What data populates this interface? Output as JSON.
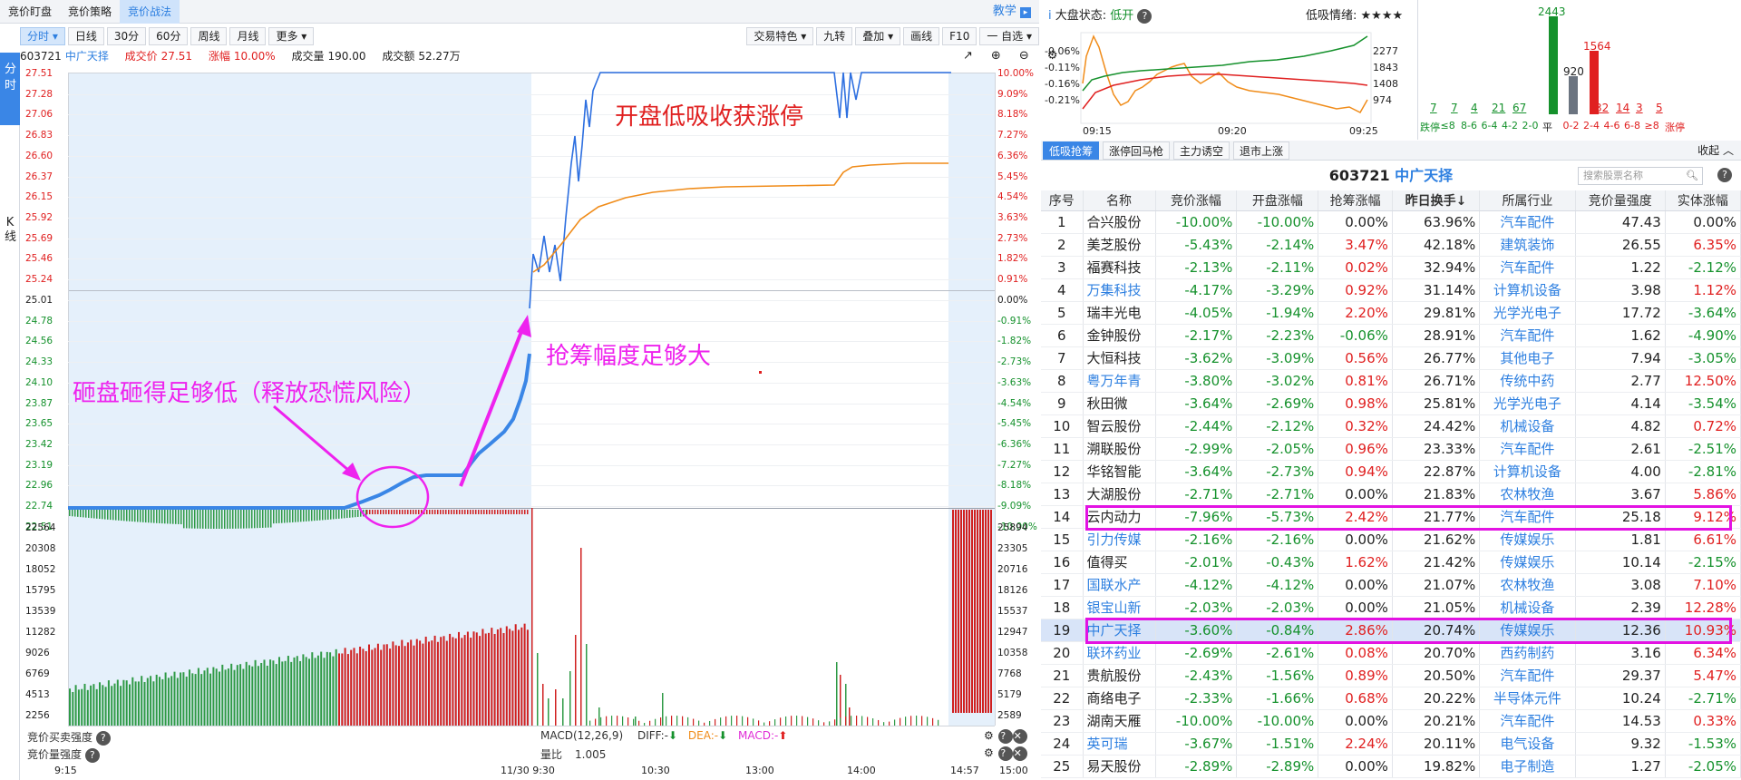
{
  "top_tabs": [
    "竞价盯盘",
    "竞价策略",
    "竞价战法"
  ],
  "teach": "教学",
  "side": {
    "fen": "分时",
    "k": "K线"
  },
  "toolbar_left": [
    "分时",
    "日线",
    "30分",
    "60分",
    "周线",
    "月线",
    "更多"
  ],
  "toolbar_right": [
    "交易特色",
    "九转",
    "叠加",
    "画线",
    "F10",
    "一 自选"
  ],
  "info": {
    "code": "603721",
    "name": "中广天择",
    "price_label": "成交价",
    "price": "27.51",
    "chg_label": "涨幅",
    "chg": "10.00%",
    "vol_label": "成交量",
    "vol": "190.00",
    "amt_label": "成交额",
    "amt": "52.27万"
  },
  "price_axis": [
    "27.51",
    "27.28",
    "27.06",
    "26.83",
    "26.60",
    "26.37",
    "26.15",
    "25.92",
    "25.69",
    "25.46",
    "25.24",
    "25.01",
    "24.78",
    "24.56",
    "24.33",
    "24.10",
    "23.87",
    "23.65",
    "23.42",
    "23.19",
    "22.96",
    "22.74",
    "22.51"
  ],
  "pct_axis": [
    "10.00%",
    "9.09%",
    "8.18%",
    "7.27%",
    "6.36%",
    "5.45%",
    "4.54%",
    "3.63%",
    "2.73%",
    "1.82%",
    "0.91%",
    "0.00%",
    "-0.91%",
    "-1.82%",
    "-2.73%",
    "-3.63%",
    "-4.54%",
    "-5.45%",
    "-6.36%",
    "-7.27%",
    "-8.18%",
    "-9.09%",
    "-10.00%"
  ],
  "vol_axis_left": [
    "22564",
    "20308",
    "18052",
    "15795",
    "13539",
    "11282",
    "9026",
    "6769",
    "4513",
    "2256"
  ],
  "vol_axis_right": [
    "25894",
    "23305",
    "20716",
    "18126",
    "15537",
    "12947",
    "10358",
    "7768",
    "5179",
    "2589"
  ],
  "bottom_labels": {
    "auction_strength": "竞价买卖强度",
    "auction_vol": "竞价量强度",
    "macd": "MACD(12,26,9)",
    "diff": "DIFF:-",
    "dea": "DEA:-",
    "macd_v": "MACD:-",
    "vr_label": "量比",
    "vr": "1.005"
  },
  "time_axis": [
    "9:15",
    "11/30 9:30",
    "10:30",
    "13:00",
    "14:00",
    "14:57",
    "15:00"
  ],
  "annotations": {
    "a1": "开盘低吸收获涨停",
    "a2": "抢筹幅度足够大",
    "a3": "砸盘砸得足够低（释放恐慌风险）"
  },
  "market": {
    "status_label": "大盘状态:",
    "status": "低开",
    "mood_label": "低吸情绪:",
    "mood": "★★★★",
    "left_axis": [
      "-0.06%",
      "-0.11%",
      "-0.16%",
      "-0.21%"
    ],
    "right_axis": [
      "2277",
      "1843",
      "1408",
      "974"
    ],
    "times": [
      "09:15",
      "09:20",
      "09:25"
    ]
  },
  "dist": {
    "tops": [
      "2443",
      "920",
      "1564"
    ],
    "counts": [
      "7",
      "7",
      "4",
      "21",
      "67",
      "",
      "",
      "32",
      "14",
      "3",
      "5"
    ],
    "labels": [
      "跌停",
      "≤8",
      "8-6",
      "6-4",
      "4-2",
      "2-0",
      "平",
      "0-2",
      "2-4",
      "4-6",
      "6-8",
      "≥8",
      "涨停"
    ]
  },
  "sub_tabs": [
    "低吸抢筹",
    "涨停回马枪",
    "主力诱空",
    "退市上涨"
  ],
  "collapse": "收起",
  "stock_title": {
    "code": "603721",
    "name": "中广天择"
  },
  "search_placeholder": "搜索股票名称",
  "headers": [
    "序号",
    "名称",
    "竞价涨幅",
    "开盘涨幅",
    "抢筹涨幅",
    "昨日换手↓",
    "所属行业",
    "竞价量强度",
    "实体涨幅"
  ],
  "rows": [
    [
      "1",
      "合兴股份",
      "-10.00%",
      "-10.00%",
      "0.00%",
      "63.96%",
      "汽车配件",
      "47.43",
      "0.00%"
    ],
    [
      "2",
      "美芝股份",
      "-5.43%",
      "-2.14%",
      "3.47%",
      "42.18%",
      "建筑装饰",
      "26.55",
      "6.35%"
    ],
    [
      "3",
      "福赛科技",
      "-2.13%",
      "-2.11%",
      "0.02%",
      "32.94%",
      "汽车配件",
      "1.22",
      "-2.12%"
    ],
    [
      "4",
      "万集科技",
      "-4.17%",
      "-3.29%",
      "0.92%",
      "31.14%",
      "计算机设备",
      "3.98",
      "1.12%"
    ],
    [
      "5",
      "瑞丰光电",
      "-4.05%",
      "-1.94%",
      "2.20%",
      "29.81%",
      "光学光电子",
      "17.72",
      "-3.64%"
    ],
    [
      "6",
      "金钟股份",
      "-2.17%",
      "-2.23%",
      "-0.06%",
      "28.91%",
      "汽车配件",
      "1.62",
      "-4.90%"
    ],
    [
      "7",
      "大恒科技",
      "-3.62%",
      "-3.09%",
      "0.56%",
      "26.77%",
      "其他电子",
      "7.94",
      "-3.05%"
    ],
    [
      "8",
      "粤万年青",
      "-3.80%",
      "-3.02%",
      "0.81%",
      "26.71%",
      "传统中药",
      "2.77",
      "12.50%"
    ],
    [
      "9",
      "秋田微",
      "-3.64%",
      "-2.69%",
      "0.98%",
      "25.81%",
      "光学光电子",
      "4.14",
      "-3.54%"
    ],
    [
      "10",
      "智云股份",
      "-2.44%",
      "-2.12%",
      "0.32%",
      "24.42%",
      "机械设备",
      "4.82",
      "0.72%"
    ],
    [
      "11",
      "溯联股份",
      "-2.99%",
      "-2.05%",
      "0.96%",
      "23.33%",
      "汽车配件",
      "2.61",
      "-2.51%"
    ],
    [
      "12",
      "华铭智能",
      "-3.64%",
      "-2.73%",
      "0.94%",
      "22.87%",
      "计算机设备",
      "4.00",
      "-2.81%"
    ],
    [
      "13",
      "大湖股份",
      "-2.71%",
      "-2.71%",
      "0.00%",
      "21.83%",
      "农林牧渔",
      "3.67",
      "5.86%"
    ],
    [
      "14",
      "云内动力",
      "-7.96%",
      "-5.73%",
      "2.42%",
      "21.77%",
      "汽车配件",
      "25.18",
      "9.12%"
    ],
    [
      "15",
      "引力传媒",
      "-2.16%",
      "-2.16%",
      "0.00%",
      "21.62%",
      "传媒娱乐",
      "1.81",
      "6.61%"
    ],
    [
      "16",
      "值得买",
      "-2.01%",
      "-0.43%",
      "1.62%",
      "21.42%",
      "传媒娱乐",
      "10.14",
      "-2.15%"
    ],
    [
      "17",
      "国联水产",
      "-4.12%",
      "-4.12%",
      "0.00%",
      "21.07%",
      "农林牧渔",
      "3.08",
      "7.10%"
    ],
    [
      "18",
      "银宝山新",
      "-2.03%",
      "-2.03%",
      "0.00%",
      "21.05%",
      "机械设备",
      "2.39",
      "12.28%"
    ],
    [
      "19",
      "中广天择",
      "-3.60%",
      "-0.84%",
      "2.86%",
      "20.74%",
      "传媒娱乐",
      "12.36",
      "10.93%"
    ],
    [
      "20",
      "联环药业",
      "-2.69%",
      "-2.61%",
      "0.08%",
      "20.70%",
      "西药制药",
      "3.16",
      "6.34%"
    ],
    [
      "21",
      "贵航股份",
      "-2.43%",
      "-1.56%",
      "0.89%",
      "20.50%",
      "汽车配件",
      "29.37",
      "5.47%"
    ],
    [
      "22",
      "商络电子",
      "-2.33%",
      "-1.66%",
      "0.68%",
      "20.22%",
      "半导体元件",
      "10.24",
      "-2.71%"
    ],
    [
      "23",
      "湖南天雁",
      "-10.00%",
      "-10.00%",
      "0.00%",
      "20.21%",
      "汽车配件",
      "14.53",
      "0.33%"
    ],
    [
      "24",
      "英可瑞",
      "-3.67%",
      "-1.51%",
      "2.24%",
      "20.11%",
      "电气设备",
      "9.32",
      "-1.53%"
    ],
    [
      "25",
      "易天股份",
      "-2.89%",
      "-2.89%",
      "0.00%",
      "19.82%",
      "电子制造",
      "1.27",
      "-2.05%"
    ]
  ],
  "blue_names": [
    "万集科技",
    "粤万年青",
    "引力传媒",
    "国联水产",
    "银宝山新",
    "中广天择",
    "联环药业",
    "英可瑞"
  ],
  "colors": {
    "up": "#e02020",
    "down": "#15912c",
    "link": "#2d7fe0",
    "accent": "#3a86e6",
    "highlight": "#e312e3"
  }
}
